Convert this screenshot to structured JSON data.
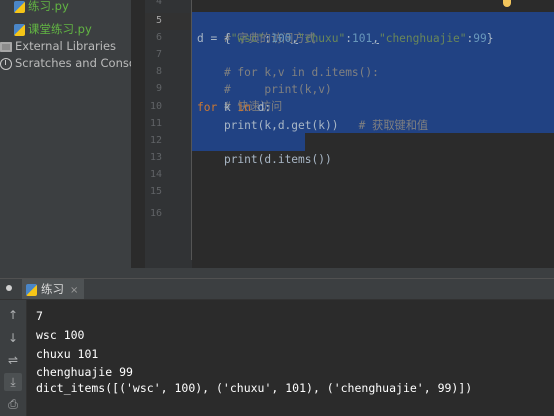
{
  "project_tree": {
    "items": [
      {
        "label": "练习.py",
        "style": "green",
        "icon": "python-file-icon"
      },
      {
        "label": "课堂练习.py",
        "style": "green",
        "icon": "python-file-icon"
      },
      {
        "label": "External Libraries",
        "style": "normal",
        "icon": "library-icon"
      },
      {
        "label": "Scratches and Consoles",
        "style": "normal",
        "icon": "scratches-icon"
      }
    ]
  },
  "editor": {
    "line_numbers": [
      "4",
      "5",
      "6",
      "7",
      "8",
      "9",
      "10",
      "11",
      "12",
      "13",
      "14",
      "15",
      "16"
    ],
    "current_line": "5",
    "lines": {
      "l5": "# 字典的访问方式",
      "l6_a": "d = {",
      "l6_k1": "\"wsc\"",
      "l6_c1": ":",
      "l6_v1": "100",
      "l6_s1": ",",
      "l6_k2": "\"chuxu\"",
      "l6_c2": ":",
      "l6_v2": "101",
      "l6_s2": ",",
      "l6_k3": "\"chenghuajie\"",
      "l6_c3": ":",
      "l6_v3": "99",
      "l6_e": "}",
      "l7": "# for k,v in d.items():",
      "l8": "#     print(k,v)",
      "l9": "# 快速访问",
      "l10_kw1": "for",
      "l10_mid": " k ",
      "l10_kw2": "in",
      "l10_end": " d:",
      "l11_code": "    print(k,d.get(k))",
      "l11_cmt": "   # 获取键和值",
      "l12": "print(d.items())"
    }
  },
  "run_panel": {
    "tab_label": "练习",
    "tab_close": "×",
    "toolbar": [
      {
        "name": "scroll-up-icon",
        "glyph": "↑"
      },
      {
        "name": "scroll-down-icon",
        "glyph": "↓"
      },
      {
        "name": "soft-wrap-icon",
        "glyph": "⇌"
      },
      {
        "name": "scroll-to-end-icon",
        "glyph": "⤓"
      },
      {
        "name": "print-icon",
        "glyph": "⎙"
      },
      {
        "name": "delete-icon",
        "glyph": "🗑"
      }
    ],
    "output": [
      "7",
      "wsc 100",
      "chuxu 101",
      "chenghuajie 99",
      "dict_items([('wsc', 100), ('chuxu', 101), ('chenghuajie', 99)])"
    ]
  },
  "colors": {
    "selection": "#214283",
    "editor_bg": "#2b2b2b",
    "panel_bg": "#3c3f41",
    "keyword": "#cc7832",
    "string": "#6a8759",
    "number": "#6897bb",
    "comment": "#808080"
  }
}
